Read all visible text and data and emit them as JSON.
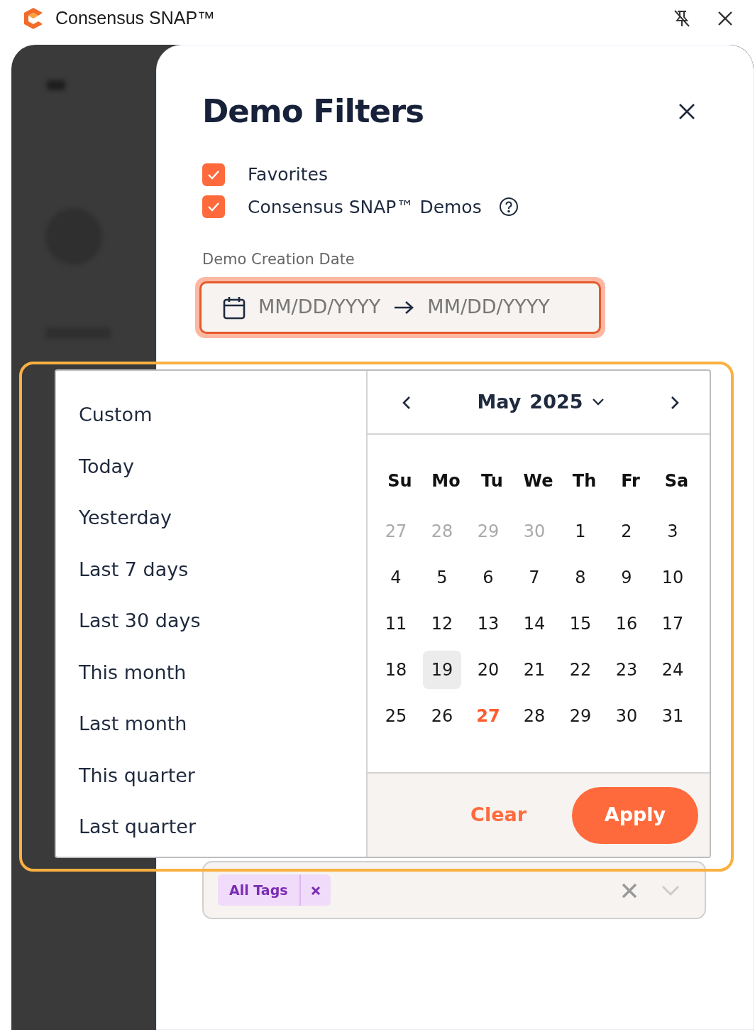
{
  "window": {
    "title": "Consensus SNAP™"
  },
  "panel": {
    "title": "Demo Filters"
  },
  "filters": [
    {
      "label": "Favorites",
      "checked": true,
      "help": false
    },
    {
      "label": "Consensus SNAP™ Demos",
      "checked": true,
      "help": true
    }
  ],
  "date_field": {
    "label": "Demo Creation Date",
    "start_placeholder": "MM/DD/YYYY",
    "end_placeholder": "MM/DD/YYYY",
    "focused": true
  },
  "presets": [
    {
      "label": "Custom"
    },
    {
      "label": "Today"
    },
    {
      "label": "Yesterday"
    },
    {
      "label": "Last 7 days"
    },
    {
      "label": "Last 30 days"
    },
    {
      "label": "This month"
    },
    {
      "label": "Last month"
    },
    {
      "label": "This quarter"
    },
    {
      "label": "Last quarter"
    }
  ],
  "calendar": {
    "month": "May",
    "year": "2025",
    "weekdays": [
      "Su",
      "Mo",
      "Tu",
      "We",
      "Th",
      "Fr",
      "Sa"
    ],
    "weeks": [
      [
        {
          "day": "27",
          "outside": true,
          "hovered": false,
          "today": false
        },
        {
          "day": "28",
          "outside": true,
          "hovered": false,
          "today": false
        },
        {
          "day": "29",
          "outside": true,
          "hovered": false,
          "today": false
        },
        {
          "day": "30",
          "outside": true,
          "hovered": false,
          "today": false
        },
        {
          "day": "1",
          "outside": false,
          "hovered": false,
          "today": false
        },
        {
          "day": "2",
          "outside": false,
          "hovered": false,
          "today": false
        },
        {
          "day": "3",
          "outside": false,
          "hovered": false,
          "today": false
        }
      ],
      [
        {
          "day": "4",
          "outside": false,
          "hovered": false,
          "today": false
        },
        {
          "day": "5",
          "outside": false,
          "hovered": false,
          "today": false
        },
        {
          "day": "6",
          "outside": false,
          "hovered": false,
          "today": false
        },
        {
          "day": "7",
          "outside": false,
          "hovered": false,
          "today": false
        },
        {
          "day": "8",
          "outside": false,
          "hovered": false,
          "today": false
        },
        {
          "day": "9",
          "outside": false,
          "hovered": false,
          "today": false
        },
        {
          "day": "10",
          "outside": false,
          "hovered": false,
          "today": false
        }
      ],
      [
        {
          "day": "11",
          "outside": false,
          "hovered": false,
          "today": false
        },
        {
          "day": "12",
          "outside": false,
          "hovered": false,
          "today": false
        },
        {
          "day": "13",
          "outside": false,
          "hovered": false,
          "today": false
        },
        {
          "day": "14",
          "outside": false,
          "hovered": false,
          "today": false
        },
        {
          "day": "15",
          "outside": false,
          "hovered": false,
          "today": false
        },
        {
          "day": "16",
          "outside": false,
          "hovered": false,
          "today": false
        },
        {
          "day": "17",
          "outside": false,
          "hovered": false,
          "today": false
        }
      ],
      [
        {
          "day": "18",
          "outside": false,
          "hovered": false,
          "today": false
        },
        {
          "day": "19",
          "outside": false,
          "hovered": true,
          "today": false
        },
        {
          "day": "20",
          "outside": false,
          "hovered": false,
          "today": false
        },
        {
          "day": "21",
          "outside": false,
          "hovered": false,
          "today": false
        },
        {
          "day": "22",
          "outside": false,
          "hovered": false,
          "today": false
        },
        {
          "day": "23",
          "outside": false,
          "hovered": false,
          "today": false
        },
        {
          "day": "24",
          "outside": false,
          "hovered": false,
          "today": false
        }
      ],
      [
        {
          "day": "25",
          "outside": false,
          "hovered": false,
          "today": false
        },
        {
          "day": "26",
          "outside": false,
          "hovered": false,
          "today": false
        },
        {
          "day": "27",
          "outside": false,
          "hovered": false,
          "today": true
        },
        {
          "day": "28",
          "outside": false,
          "hovered": false,
          "today": false
        },
        {
          "day": "29",
          "outside": false,
          "hovered": false,
          "today": false
        },
        {
          "day": "30",
          "outside": false,
          "hovered": false,
          "today": false
        },
        {
          "day": "31",
          "outside": false,
          "hovered": false,
          "today": false
        }
      ]
    ],
    "buttons": [
      {
        "label": "Clear",
        "kind": "link"
      },
      {
        "label": "Apply",
        "kind": "primary"
      }
    ]
  },
  "tags_field": {
    "tags": [
      {
        "label": "All Tags"
      }
    ]
  }
}
